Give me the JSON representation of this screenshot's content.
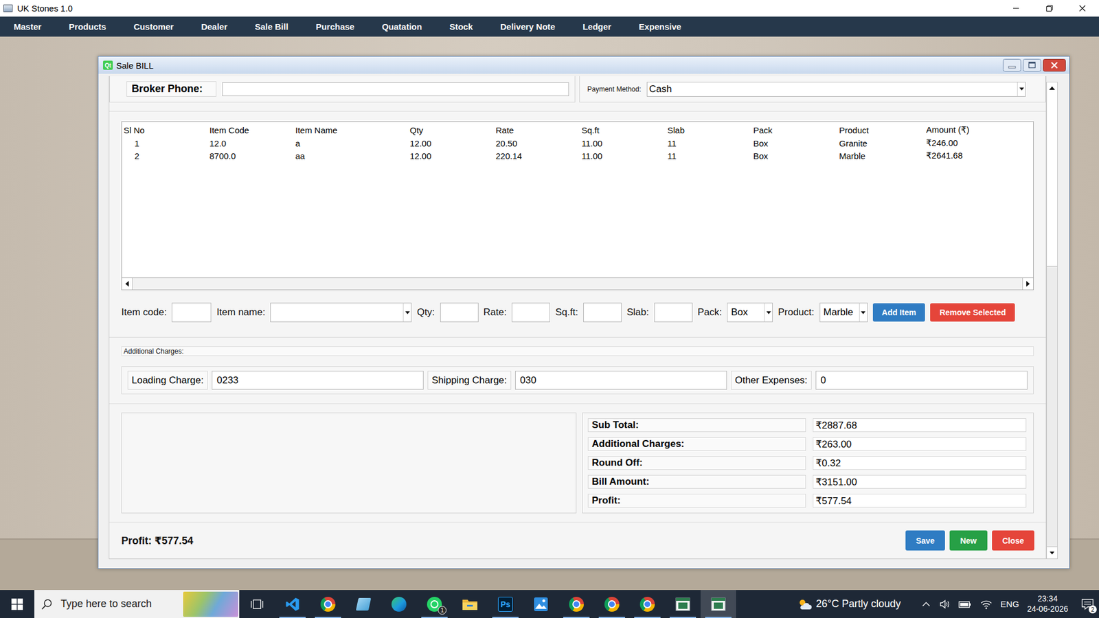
{
  "app": {
    "title": "UK Stones 1.0"
  },
  "menu": [
    "Master",
    "Products",
    "Customer",
    "Dealer",
    "Sale Bill",
    "Purchase",
    "Quatation",
    "Stock",
    "Delivery Note",
    "Ledger",
    "Expensive"
  ],
  "window": {
    "title": "Sale BILL",
    "icon": "Qt"
  },
  "broker": {
    "label": "Broker Phone:",
    "value": ""
  },
  "payment": {
    "label": "Payment Method:",
    "value": "Cash"
  },
  "table": {
    "columns": [
      "Sl No",
      "Item Code",
      "Item Name",
      "Qty",
      "Rate",
      "Sq.ft",
      "Slab",
      "Pack",
      "Product",
      "Amount (₹)"
    ],
    "rows": [
      {
        "cells": [
          "1",
          "12.0",
          "a",
          "12.00",
          "20.50",
          "11.00",
          "11",
          "Box",
          "Granite",
          "₹246.00"
        ],
        "selected": false
      },
      {
        "cells": [
          "2",
          "8700.0",
          "aa",
          "12.00",
          "220.14",
          "11.00",
          "11",
          "Box",
          "Marble",
          "₹2641.68"
        ],
        "selected": false
      }
    ],
    "hscroll": {
      "level": 1
    }
  },
  "entry": {
    "fields": [
      {
        "label": "Item code:",
        "kind": "input",
        "value": ""
      },
      {
        "label": "Item name:",
        "kind": "combo",
        "value": ""
      },
      {
        "label": "Qty:",
        "kind": "input",
        "value": ""
      },
      {
        "label": "Rate:",
        "kind": "input",
        "value": ""
      },
      {
        "label": "Sq.ft:",
        "kind": "input",
        "value": ""
      },
      {
        "label": "Slab:",
        "kind": "input",
        "value": ""
      },
      {
        "label": "Pack:",
        "kind": "combo",
        "value": "Box"
      },
      {
        "label": "Product:",
        "kind": "combo",
        "value": "Marble"
      }
    ],
    "buttons": [
      {
        "label": "Add Item",
        "color": "#2f7cc3"
      },
      {
        "label": "Remove Selected",
        "color": "#e5453a"
      }
    ]
  },
  "charges": {
    "title": "Additional Charges:",
    "fields": [
      {
        "label": "Loading Charge:",
        "value": "0233"
      },
      {
        "label": "Shipping Charge:",
        "value": "030"
      },
      {
        "label": "Other Expenses:",
        "value": "0"
      }
    ]
  },
  "summary": [
    {
      "label": "Sub Total:",
      "value": "₹2887.68"
    },
    {
      "label": "Additional Charges:",
      "value": "₹263.00"
    },
    {
      "label": "Round Off:",
      "value": "₹0.32"
    },
    {
      "label": "Bill Amount:",
      "value": "₹3151.00"
    },
    {
      "label": "Profit:",
      "value": "₹577.54"
    }
  ],
  "footer": {
    "profit": "Profit: ₹577.54",
    "buttons": [
      {
        "label": "Save",
        "color": "#2f7cc3"
      },
      {
        "label": "New",
        "color": "#27a046"
      },
      {
        "label": "Close",
        "color": "#e5453a"
      }
    ]
  },
  "vscroll": {
    "level": 0.62
  },
  "taskbar": {
    "search": "Type here to search",
    "apps": [
      {
        "kind": "taskview",
        "label": "",
        "badge": "",
        "open": false,
        "active": false
      },
      {
        "kind": "vscode",
        "label": "",
        "badge": "",
        "open": true,
        "active": false
      },
      {
        "kind": "chrome",
        "label": "",
        "badge": "",
        "open": true,
        "active": false
      },
      {
        "kind": "notes",
        "label": "",
        "badge": "",
        "open": false,
        "active": false
      },
      {
        "kind": "edge",
        "label": "",
        "badge": "",
        "open": false,
        "active": false
      },
      {
        "kind": "whatsapp",
        "label": "",
        "badge": "1",
        "open": true,
        "active": false
      },
      {
        "kind": "explorer",
        "label": "",
        "badge": "",
        "open": false,
        "active": false
      },
      {
        "kind": "ps",
        "label": "Ps",
        "badge": "",
        "open": true,
        "active": false
      },
      {
        "kind": "photos",
        "label": "",
        "badge": "",
        "open": false,
        "active": false
      },
      {
        "kind": "chrome",
        "label": "",
        "badge": "",
        "open": true,
        "active": false
      },
      {
        "kind": "chrome",
        "label": "",
        "badge": "",
        "open": true,
        "active": false
      },
      {
        "kind": "chrome",
        "label": "",
        "badge": "",
        "open": true,
        "active": false
      },
      {
        "kind": "window",
        "label": "",
        "badge": "",
        "open": true,
        "active": false
      },
      {
        "kind": "window",
        "label": "",
        "badge": "",
        "open": true,
        "active": true
      }
    ],
    "weather": "26°C Partly cloudy",
    "language": "ENG",
    "time": "23:34",
    "date": "24-06-2026",
    "notifications": "2"
  }
}
